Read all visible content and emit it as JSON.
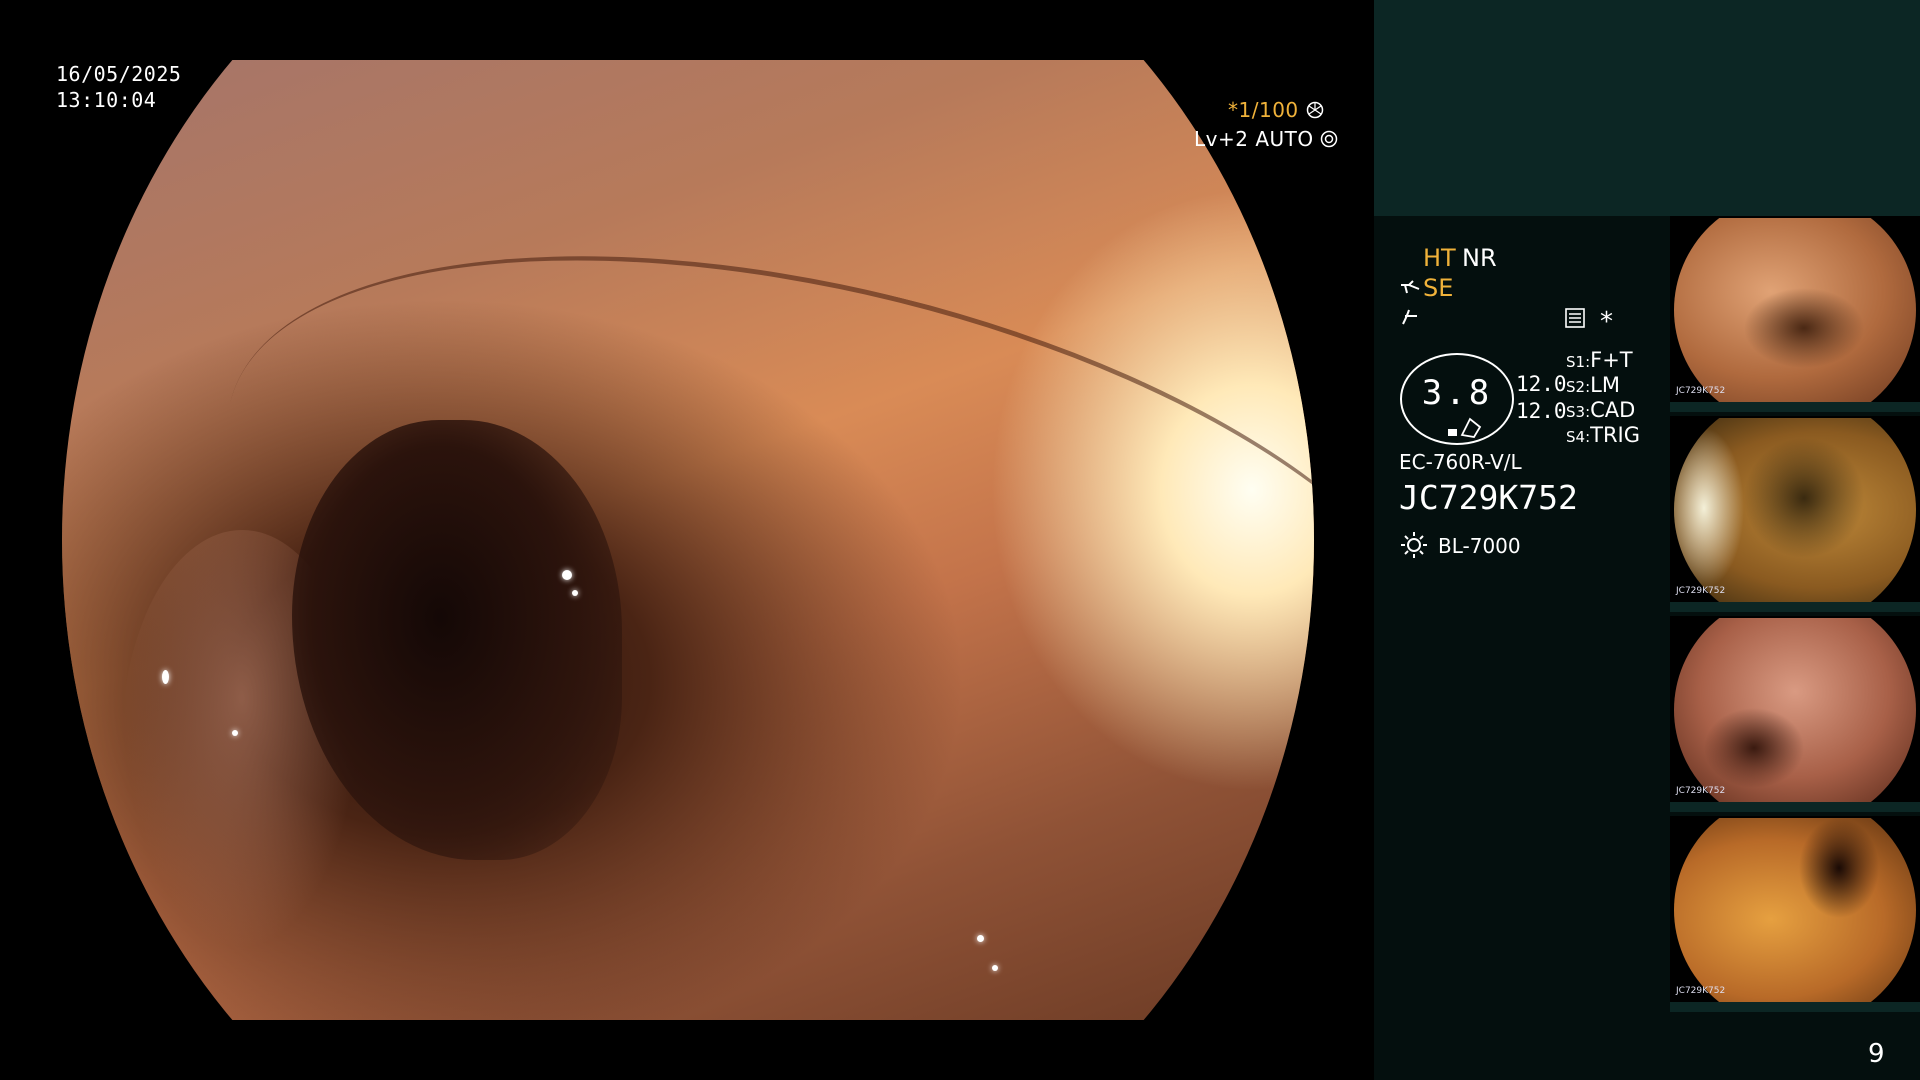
{
  "overlay": {
    "date": "16/05/2025",
    "time": "13:10:04",
    "shutter": "*1/100",
    "level": "Lv+2 AUTO"
  },
  "panel": {
    "ht": "HT",
    "nr": "NR",
    "se": "SE",
    "star": "*",
    "zoom_value": "3.8",
    "val_a": "12.0",
    "val_b": "12.0",
    "settings": [
      {
        "key": "S1:",
        "value": "F+T"
      },
      {
        "key": "S2:",
        "value": "LM"
      },
      {
        "key": "S3:",
        "value": "CAD"
      },
      {
        "key": "S4:",
        "value": "TRIG"
      }
    ],
    "scope_model": "EC-760R-V/L",
    "serial": "JC729K752",
    "light_source": "BL-7000",
    "page_number": "9",
    "thumbnail_labels": [
      "JC729K752",
      "JC729K752",
      "JC729K752",
      "JC729K752"
    ]
  },
  "colors": {
    "panel_bg": "#040f0e",
    "panel_top": "#0c2624",
    "accent_yellow": "#f0b23a"
  },
  "icons": [
    "aperture-icon",
    "auto-iris-icon",
    "enhancement-icon",
    "color-icon",
    "settings-icon",
    "lamp-icon"
  ]
}
